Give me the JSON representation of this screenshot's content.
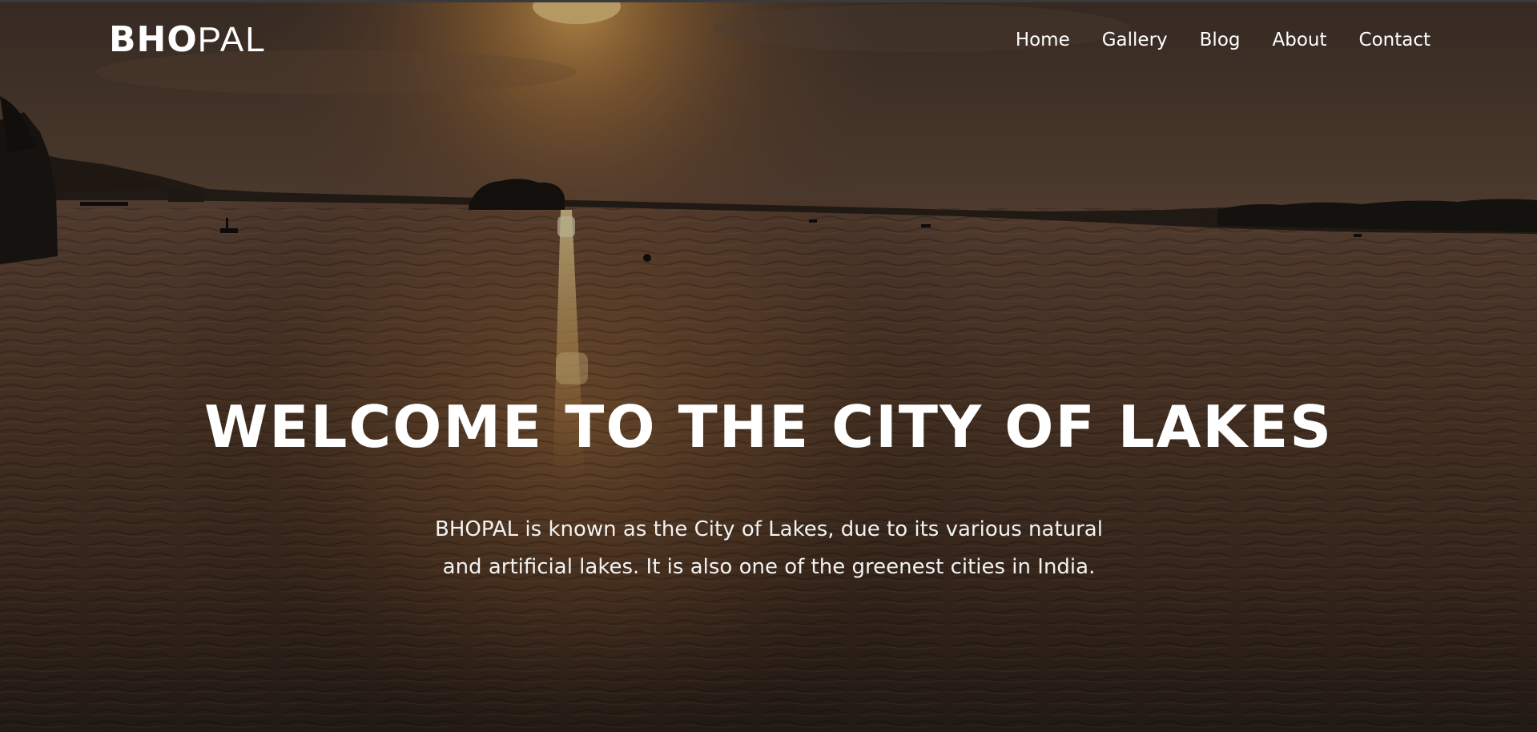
{
  "navbar": {
    "logo": {
      "bold_part": "BHO",
      "light_part": "PAL"
    },
    "links": [
      {
        "label": "Home"
      },
      {
        "label": "Gallery"
      },
      {
        "label": "Blog"
      },
      {
        "label": "About"
      },
      {
        "label": "Contact"
      }
    ]
  },
  "hero": {
    "title": "WELCOME TO THE CITY OF LAKES",
    "description": "BHOPAL is known as the City of Lakes, due to its various natural and artificial lakes. It is also one of the greenest cities in India."
  },
  "background": {
    "subject": "sunset over lake",
    "sky_color": "#5b463a",
    "sun_color": "#f7c15a",
    "water_color": "#6a4a33",
    "overlay_color": "#000000"
  }
}
